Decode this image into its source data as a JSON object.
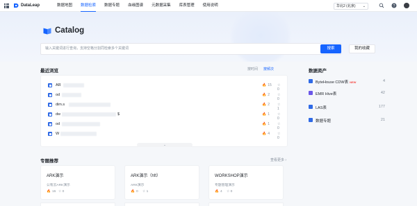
{
  "topbar": {
    "brand": "DataLeap",
    "nav": [
      "数据地图",
      "数据检索",
      "数据专题",
      "血缘图谱",
      "元数据采集",
      "库表管理",
      "使用说明"
    ],
    "active_nav_index": 1,
    "region": "华北2 (北京)"
  },
  "hero": {
    "title": "Catalog",
    "search_placeholder": "输入关键词进行查询，支持空格分割同检索多个关键词",
    "search_button": "搜索",
    "favorites_button": "我的收藏"
  },
  "recent": {
    "title": "最近浏览",
    "sort_time": "按时间",
    "sort_freq": "按频次",
    "items": [
      {
        "name": "AR",
        "fires": "15",
        "stars": "0"
      },
      {
        "name": "od",
        "fires": "2",
        "stars": "0"
      },
      {
        "name": "dim.s",
        "fires": "2",
        "stars": "1"
      },
      {
        "name": "dw",
        "suffix": "$",
        "fires": "1",
        "stars": "0"
      },
      {
        "name": "od",
        "fires": "1",
        "stars": "0"
      },
      {
        "name": "W",
        "fires": "4",
        "stars": "0"
      }
    ]
  },
  "assets": {
    "title": "数据资产",
    "items": [
      {
        "name": "ByteHouse CDW表",
        "badge": "NEW",
        "count": "4",
        "color": "#2f6ae6"
      },
      {
        "name": "EMR Hive表",
        "badge": "",
        "count": "42",
        "color": "#6b57e8"
      },
      {
        "name": "LAS表",
        "badge": "",
        "count": "177",
        "color": "#2f6ae6"
      },
      {
        "name": "数据专题",
        "badge": "",
        "count": "21",
        "color": "#2f6ae6"
      }
    ]
  },
  "topics": {
    "title": "专题推荐",
    "more": "查看更多",
    "cards": [
      {
        "title": "ARK演示",
        "desc": "公有云ARK演示",
        "fires": "15",
        "stars": "0"
      },
      {
        "title": "ARK演示（hft）",
        "desc": "ARK演示",
        "fires": "0",
        "stars": "1"
      },
      {
        "title": "WORKSHOP演示",
        "desc": "专题管理演示",
        "fires": "4",
        "stars": "0"
      }
    ]
  },
  "colors": {
    "accent": "#1664ff",
    "fire": "#f54a45"
  }
}
